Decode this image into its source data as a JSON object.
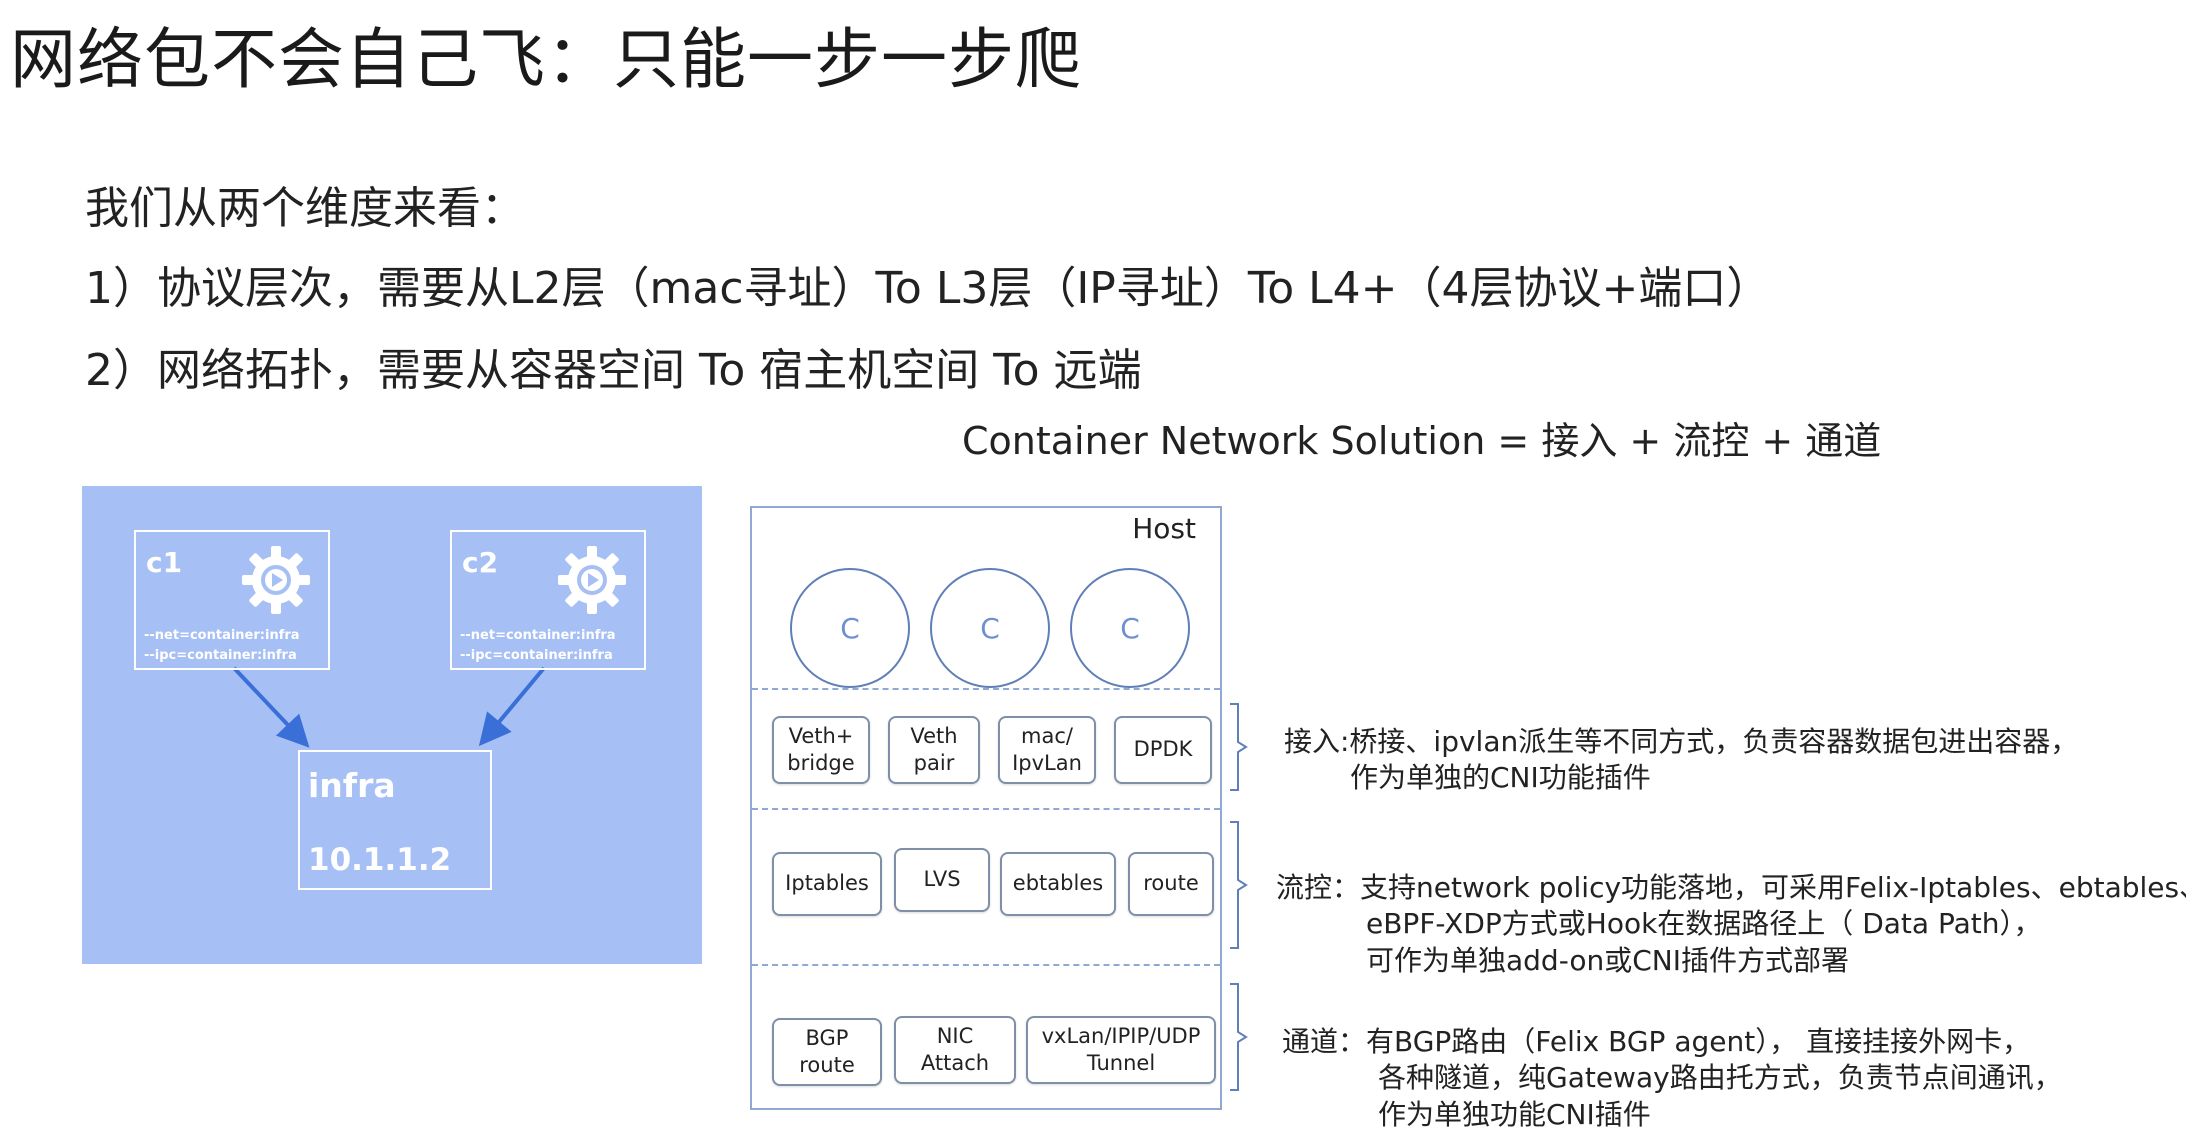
{
  "title": "网络包不会自己飞：只能一步一步爬",
  "lines": [
    "我们从两个维度来看：",
    "1）协议层次，需要从L2层（mac寻址）To  L3层（IP寻址）To  L4+（4层协议+端口）",
    "2）网络拓扑，需要从容器空间  To  宿主机空间  To 远端"
  ],
  "formula": "Container Network Solution = 接入 + 流控 + 通道",
  "left_diagram": {
    "containers": [
      {
        "name": "c1",
        "opt1": "--net=container:infra",
        "opt2": "--ipc=container:infra"
      },
      {
        "name": "c2",
        "opt1": "--net=container:infra",
        "opt2": "--ipc=container:infra"
      }
    ],
    "infra": {
      "name": "infra",
      "ip": "10.1.1.2"
    },
    "colors": {
      "panel": "#a6bff4",
      "arrow": "#3a6fd8",
      "gear": "#ffffff"
    },
    "icon": "gear-play-icon"
  },
  "host": {
    "label": "Host",
    "circles": [
      "C",
      "C",
      "C"
    ],
    "access_row": [
      "Veth+\nbridge",
      "Veth\npair",
      "mac/\nIpvLan",
      "DPDK"
    ],
    "flow_row": [
      "Iptables",
      "LVS",
      "ebtables",
      "route"
    ],
    "tunnel_row": [
      "BGP\nroute",
      "NIC\nAttach",
      "vxLan/IPIP/UDP\nTunnel"
    ]
  },
  "descriptions": {
    "access": [
      "接入:桥接、ipvlan派生等不同方式，负责容器数据包进出容器，",
      "作为单独的CNI功能插件"
    ],
    "flow": [
      "流控：支持network policy功能落地，可采用Felix-Iptables、ebtables、",
      "eBPF-XDP方式或Hook在数据路径上（ Data Path），",
      "可作为单独add-on或CNI插件方式部署"
    ],
    "tunnel": [
      "通道：有BGP路由（Felix BGP agent），  直接挂接外网卡，",
      "各种隧道，纯Gateway路由托方式，负责节点间通讯，",
      "作为单独功能CNI插件"
    ]
  }
}
